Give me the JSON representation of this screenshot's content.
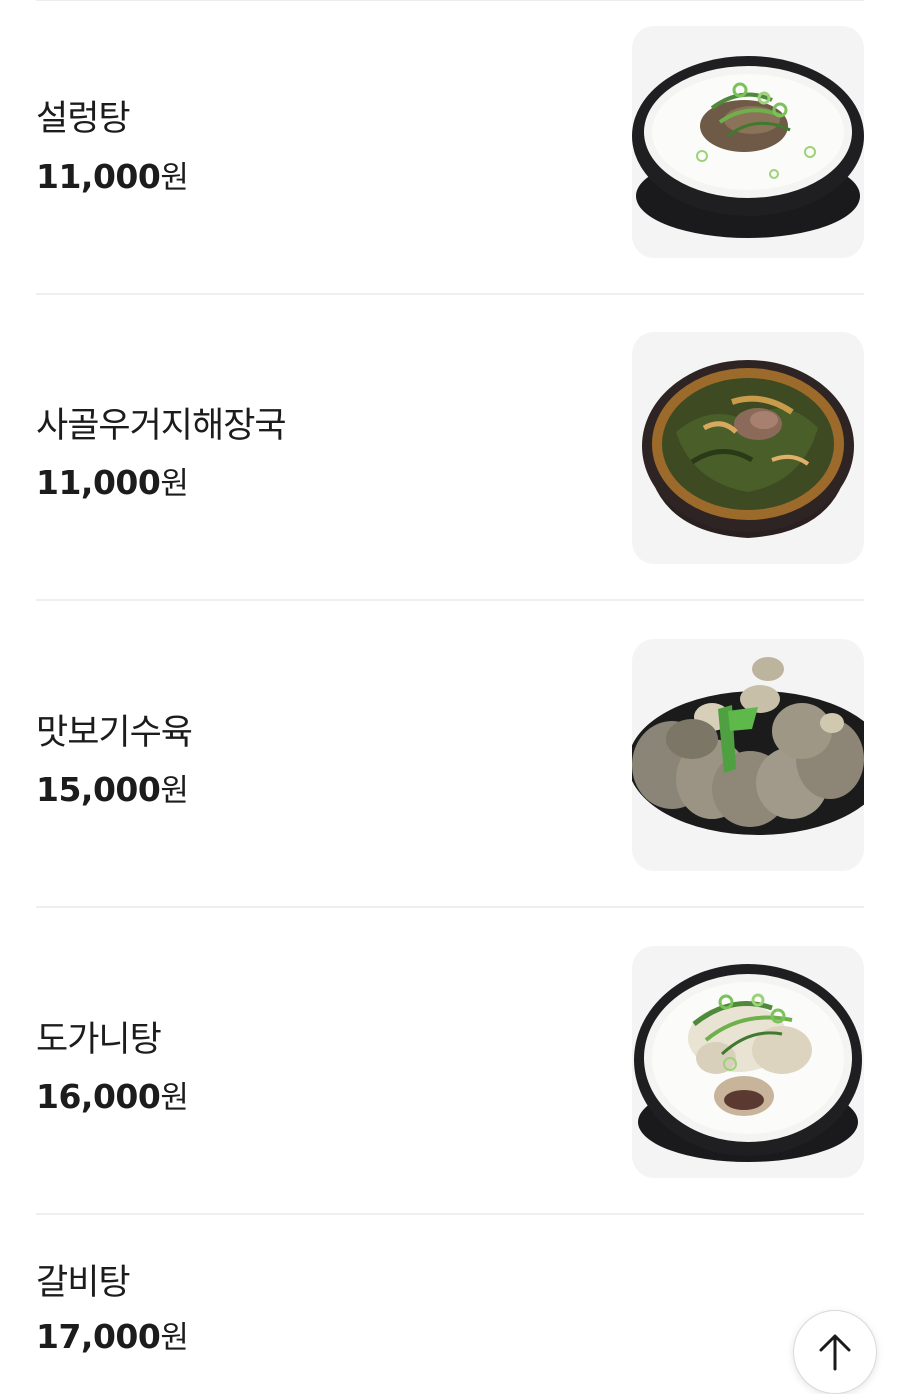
{
  "menu": {
    "items": [
      {
        "name": "설렁탕",
        "price": "11,000",
        "currency": "원",
        "image_icon": "seolleongtang-photo"
      },
      {
        "name": "사골우거지해장국",
        "price": "11,000",
        "currency": "원",
        "image_icon": "ugeoji-haejangguk-photo"
      },
      {
        "name": "맛보기수육",
        "price": "15,000",
        "currency": "원",
        "image_icon": "suyuk-photo"
      },
      {
        "name": "도가니탕",
        "price": "16,000",
        "currency": "원",
        "image_icon": "doganitang-photo"
      },
      {
        "name": "갈비탕",
        "price": "17,000",
        "currency": "원"
      }
    ]
  },
  "scroll_top_icon": "arrow-up-icon"
}
